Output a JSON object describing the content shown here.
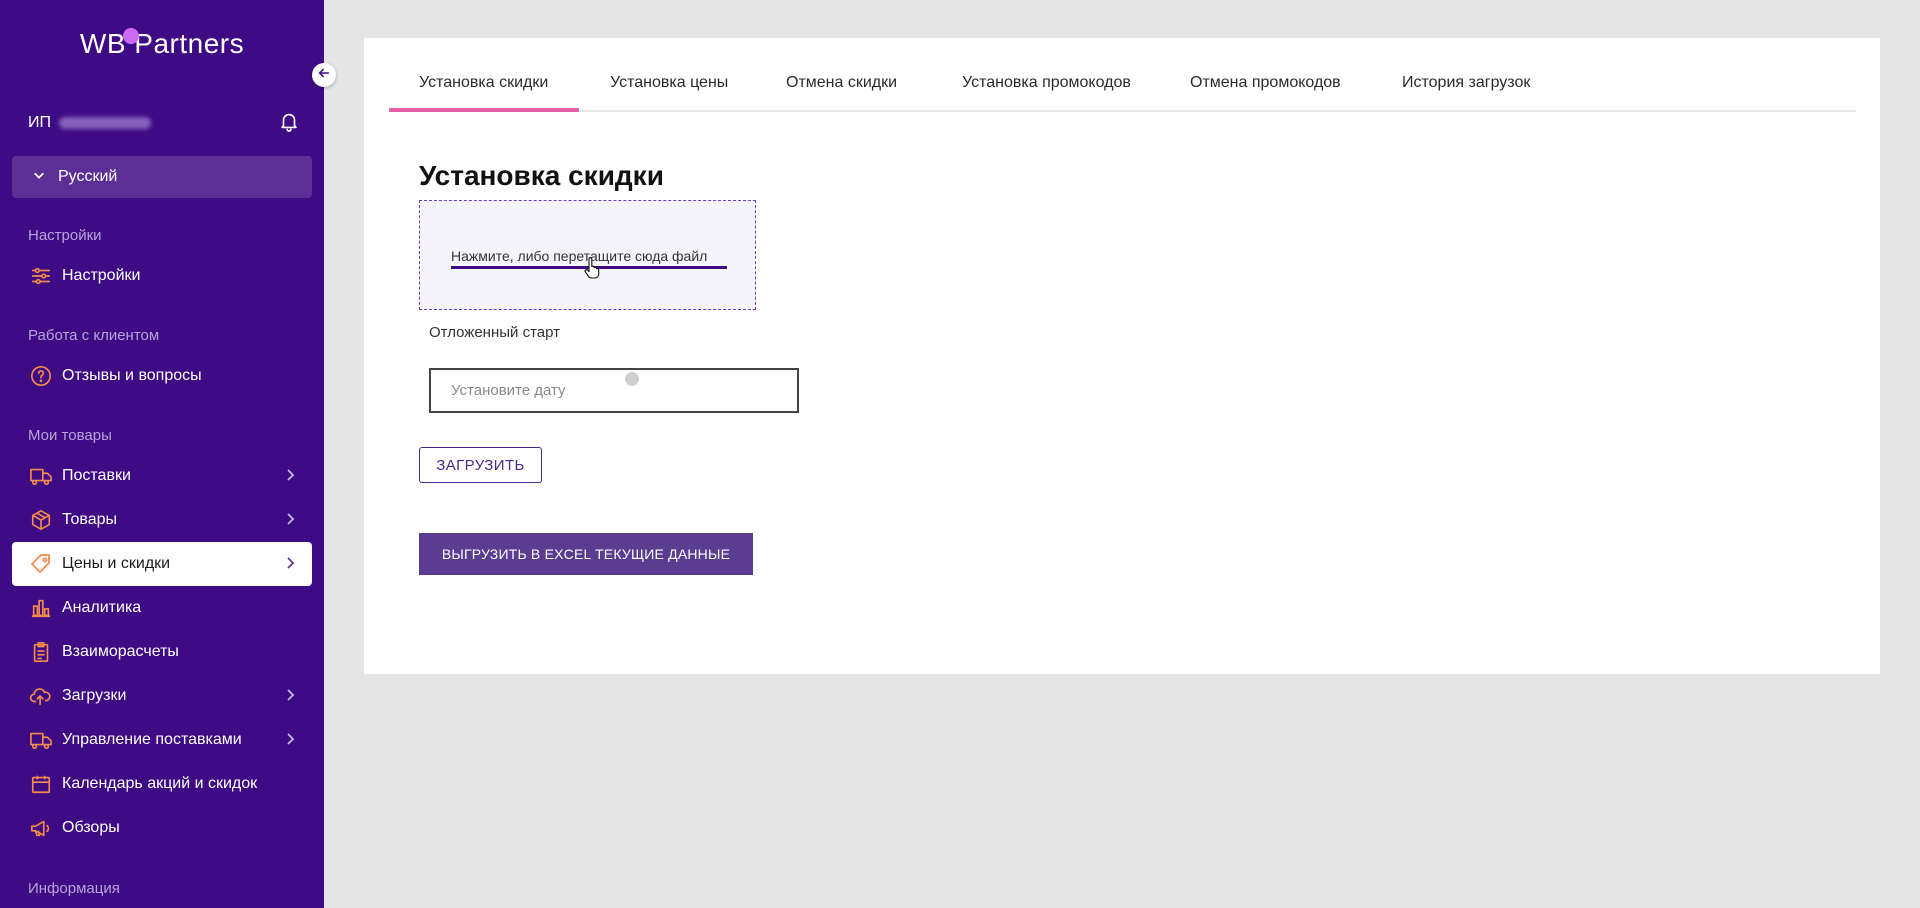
{
  "app": {
    "logo_text": "WB Partners"
  },
  "sidebar": {
    "user_prefix": "ИП",
    "language": "Русский",
    "sections": [
      {
        "title": "Настройки",
        "items": [
          {
            "label": "Настройки",
            "icon": "sliders-icon"
          }
        ]
      },
      {
        "title": "Работа с клиентом",
        "items": [
          {
            "label": "Отзывы и вопросы",
            "icon": "question-circle-icon"
          }
        ]
      },
      {
        "title": "Мои товары",
        "items": [
          {
            "label": "Поставки",
            "icon": "truck-icon",
            "chevron": true
          },
          {
            "label": "Товары",
            "icon": "box-icon",
            "chevron": true
          },
          {
            "label": "Цены и скидки",
            "icon": "tag-icon",
            "chevron": true,
            "active": true
          },
          {
            "label": "Аналитика",
            "icon": "bar-chart-icon"
          },
          {
            "label": "Взаиморасчеты",
            "icon": "clipboard-icon"
          },
          {
            "label": "Загрузки",
            "icon": "cloud-upload-icon",
            "chevron": true
          },
          {
            "label": "Управление поставками",
            "icon": "truck-icon",
            "chevron": true
          },
          {
            "label": "Календарь акций и скидок",
            "icon": "calendar-icon"
          },
          {
            "label": "Обзоры",
            "icon": "megaphone-icon"
          }
        ]
      },
      {
        "title": "Информация",
        "items": []
      }
    ]
  },
  "tabs": [
    {
      "label": "Установка скидки",
      "active": true
    },
    {
      "label": "Установка цены"
    },
    {
      "label": "Отмена скидки"
    },
    {
      "label": "Установка промокодов"
    },
    {
      "label": "Отмена промокодов"
    },
    {
      "label": "История загрузок"
    }
  ],
  "main": {
    "title": "Установка скидки",
    "dropzone_text": "Нажмите, либо перетащите сюда файл",
    "delayed_label": "Отложенный старт",
    "date_placeholder": "Установите дату",
    "upload_button": "ЗАГРУЗИТЬ",
    "export_button": "ВЫГРУЗИТЬ В EXCEL ТЕКУЩИЕ ДАННЫЕ"
  },
  "colors": {
    "sidebar_bg": "#3f0b84",
    "accent_pink": "#e45fa8",
    "icon_orange": "#f28b4b",
    "button_purple": "#5a3c91"
  }
}
